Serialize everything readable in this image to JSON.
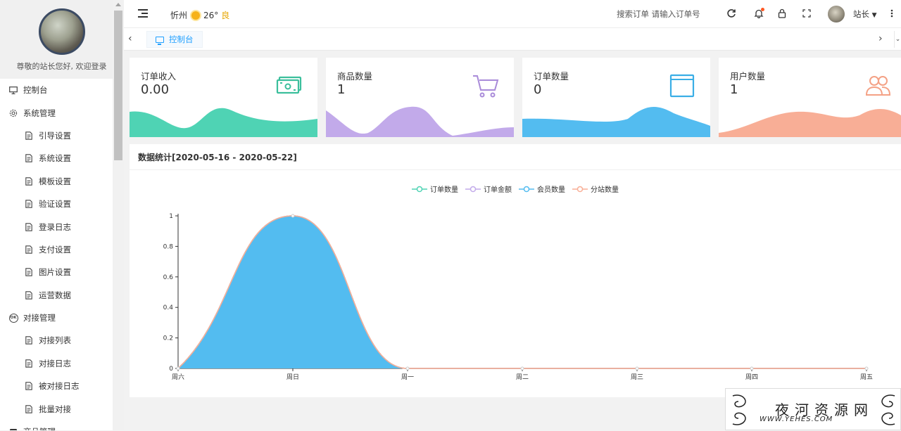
{
  "sidebar": {
    "welcome": "尊敬的站长您好, 欢迎登录",
    "items": [
      {
        "label": "控制台",
        "level": "top",
        "icon": "monitor-icon"
      },
      {
        "label": "系统管理",
        "level": "top",
        "icon": "gear-icon"
      },
      {
        "label": "引导设置",
        "level": "sub",
        "icon": "document-icon"
      },
      {
        "label": "系统设置",
        "level": "sub",
        "icon": "document-icon"
      },
      {
        "label": "模板设置",
        "level": "sub",
        "icon": "document-icon"
      },
      {
        "label": "验证设置",
        "level": "sub",
        "icon": "document-icon"
      },
      {
        "label": "登录日志",
        "level": "sub",
        "icon": "document-icon"
      },
      {
        "label": "支付设置",
        "level": "sub",
        "icon": "document-icon"
      },
      {
        "label": "图片设置",
        "level": "sub",
        "icon": "document-icon"
      },
      {
        "label": "运营数据",
        "level": "sub",
        "icon": "document-icon"
      },
      {
        "label": "对接管理",
        "level": "top",
        "icon": "ok-circle-icon"
      },
      {
        "label": "对接列表",
        "level": "sub",
        "icon": "document-icon"
      },
      {
        "label": "对接日志",
        "level": "sub",
        "icon": "document-icon"
      },
      {
        "label": "被对接日志",
        "level": "sub",
        "icon": "document-icon"
      },
      {
        "label": "批量对接",
        "level": "sub",
        "icon": "document-icon"
      },
      {
        "label": "商品管理",
        "level": "top",
        "icon": "box-icon"
      }
    ]
  },
  "header": {
    "city": "忻州",
    "temperature": "26°",
    "air_quality": "良",
    "search_text": "搜索订单 请输入订单号",
    "user_name": "站长"
  },
  "tabs": {
    "active_label": "控制台"
  },
  "cards": [
    {
      "title": "订单收入",
      "value": "0.00",
      "icon": "money-icon",
      "color": "#4fd3b4",
      "iconColor": "#3bbf9c"
    },
    {
      "title": "商品数量",
      "value": "1",
      "icon": "cart-icon",
      "color": "#c2aaea",
      "iconColor": "#a98bd9"
    },
    {
      "title": "订单数量",
      "value": "0",
      "icon": "window-icon",
      "color": "#53bcf0",
      "iconColor": "#3aaee6"
    },
    {
      "title": "用户数量",
      "value": "1",
      "icon": "users-icon",
      "color": "#f8ae96",
      "iconColor": "#f4a185"
    }
  ],
  "panel": {
    "title": "数据统计[2020-05-16 - 2020-05-22]"
  },
  "chart_data": {
    "type": "area",
    "categories": [
      "周六",
      "周日",
      "周一",
      "周二",
      "周三",
      "周四",
      "周五"
    ],
    "ylim": [
      0,
      1
    ],
    "yticks": [
      "0",
      "0.2",
      "0.4",
      "0.6",
      "0.8",
      "1"
    ],
    "smooth": true,
    "series": [
      {
        "name": "订单数量",
        "values": [
          0,
          1,
          0,
          0,
          0,
          0,
          0
        ],
        "color": "#4fd3b4"
      },
      {
        "name": "订单金额",
        "values": [
          0,
          1,
          0,
          0,
          0,
          0,
          0
        ],
        "color": "#c2aaea"
      },
      {
        "name": "会员数量",
        "values": [
          0,
          1,
          0,
          0,
          0,
          0,
          0
        ],
        "color": "#53bcf0"
      },
      {
        "name": "分站数量",
        "values": [
          0,
          1,
          0,
          0,
          0,
          0,
          0
        ],
        "color": "#f8ae96"
      }
    ]
  },
  "watermark": {
    "text": "夜河资源网",
    "url": "WWW.YEHES.COM"
  }
}
